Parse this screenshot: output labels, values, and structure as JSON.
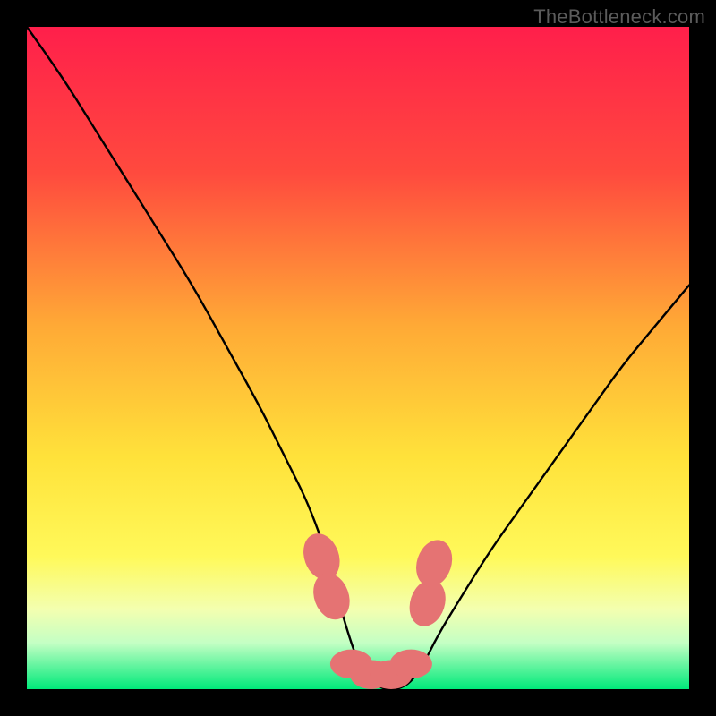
{
  "watermark": "TheBottleneck.com",
  "chart_data": {
    "type": "line",
    "title": "",
    "xlabel": "",
    "ylabel": "",
    "xlim": [
      0,
      100
    ],
    "ylim": [
      0,
      100
    ],
    "gradient_stops": [
      {
        "offset": 0,
        "color": "#ff1f4b"
      },
      {
        "offset": 22,
        "color": "#ff4a3e"
      },
      {
        "offset": 45,
        "color": "#ffa936"
      },
      {
        "offset": 65,
        "color": "#ffe23a"
      },
      {
        "offset": 80,
        "color": "#fff95a"
      },
      {
        "offset": 88,
        "color": "#f3ffb0"
      },
      {
        "offset": 93,
        "color": "#c4ffc4"
      },
      {
        "offset": 100,
        "color": "#00e97a"
      }
    ],
    "series": [
      {
        "name": "bottleneck-curve",
        "x": [
          0,
          5,
          10,
          15,
          20,
          25,
          30,
          35,
          38,
          40,
          42,
          44,
          46,
          47,
          48,
          50,
          52,
          54,
          55,
          56,
          58,
          60,
          62,
          65,
          70,
          75,
          80,
          85,
          90,
          95,
          100
        ],
        "y": [
          100,
          93,
          85,
          77,
          69,
          61,
          52,
          43,
          37,
          33,
          29,
          24,
          18,
          14,
          10,
          4,
          1,
          0,
          0,
          0,
          1,
          4,
          8,
          13,
          21,
          28,
          35,
          42,
          49,
          55,
          61
        ]
      }
    ],
    "markers": {
      "name": "highlight-points",
      "color": "#e57373",
      "points": [
        {
          "x": 44.5,
          "y": 20,
          "rx": 2.6,
          "ry": 3.6,
          "rot": -20
        },
        {
          "x": 46,
          "y": 14,
          "rx": 2.6,
          "ry": 3.6,
          "rot": -20
        },
        {
          "x": 49,
          "y": 3.8,
          "rx": 3.2,
          "ry": 2.2,
          "rot": 0
        },
        {
          "x": 52,
          "y": 2.2,
          "rx": 3.2,
          "ry": 2.2,
          "rot": 0
        },
        {
          "x": 55,
          "y": 2.2,
          "rx": 3.2,
          "ry": 2.2,
          "rot": 0
        },
        {
          "x": 58,
          "y": 3.8,
          "rx": 3.2,
          "ry": 2.2,
          "rot": 0
        },
        {
          "x": 60.5,
          "y": 13,
          "rx": 2.6,
          "ry": 3.6,
          "rot": 18
        },
        {
          "x": 61.5,
          "y": 19,
          "rx": 2.6,
          "ry": 3.6,
          "rot": 18
        }
      ]
    }
  }
}
